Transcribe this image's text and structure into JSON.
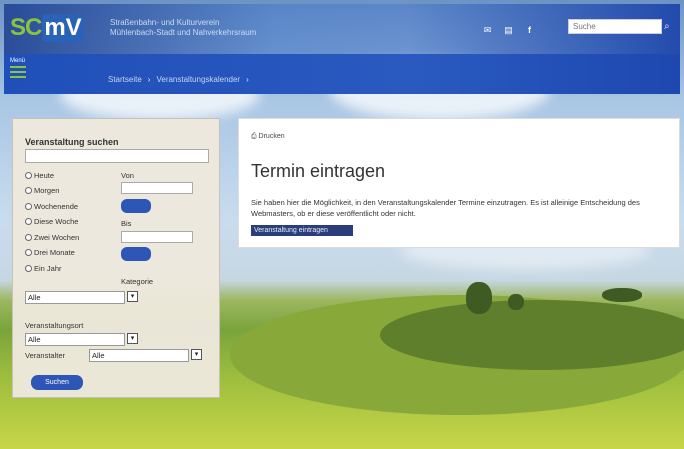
{
  "header": {
    "tagline_line1": "Straßenbahn- und Kulturverein",
    "tagline_line2": "Mühlenbach-Stadt und Nahverkehrsraum",
    "search_placeholder": "Suche",
    "icons": [
      "mail-icon",
      "print-icon",
      "facebook-icon"
    ]
  },
  "logo": {
    "part1": "SC",
    "part2": "mV"
  },
  "nav": {
    "menu_label": "Menü",
    "breadcrumbs": [
      "Startseite",
      "Veranstaltungskalender"
    ]
  },
  "search_panel": {
    "title": "Veranstaltung suchen",
    "range_options": [
      "Heute",
      "Morgen",
      "Wochenende",
      "Diese Woche",
      "Zwei Wochen",
      "Drei Monate",
      "Ein Jahr"
    ],
    "von_label": "Von",
    "bis_label": "Bis",
    "kategorie_label": "Kategorie",
    "kategorie_value": "Alle",
    "ort_label": "Veranstaltungsort",
    "ort_value": "Alle",
    "veranstalter_label": "Veranstalter",
    "veranstalter_value": "Alle",
    "search_button": "Suchen"
  },
  "content": {
    "print_label": "Drucken",
    "title": "Termin eintragen",
    "description": "Sie haben hier die Möglichkeit, in den Veranstaltungskalender Termine einzutragen. Es ist alleinige Entscheidung des Webmasters, ob er diese veröffentlicht oder nicht.",
    "link_label": "Veranstaltung eintragen"
  },
  "colors": {
    "brand_blue": "#2a5ac0",
    "brand_green": "#8ac43f",
    "button_blue": "#2d56b6"
  }
}
